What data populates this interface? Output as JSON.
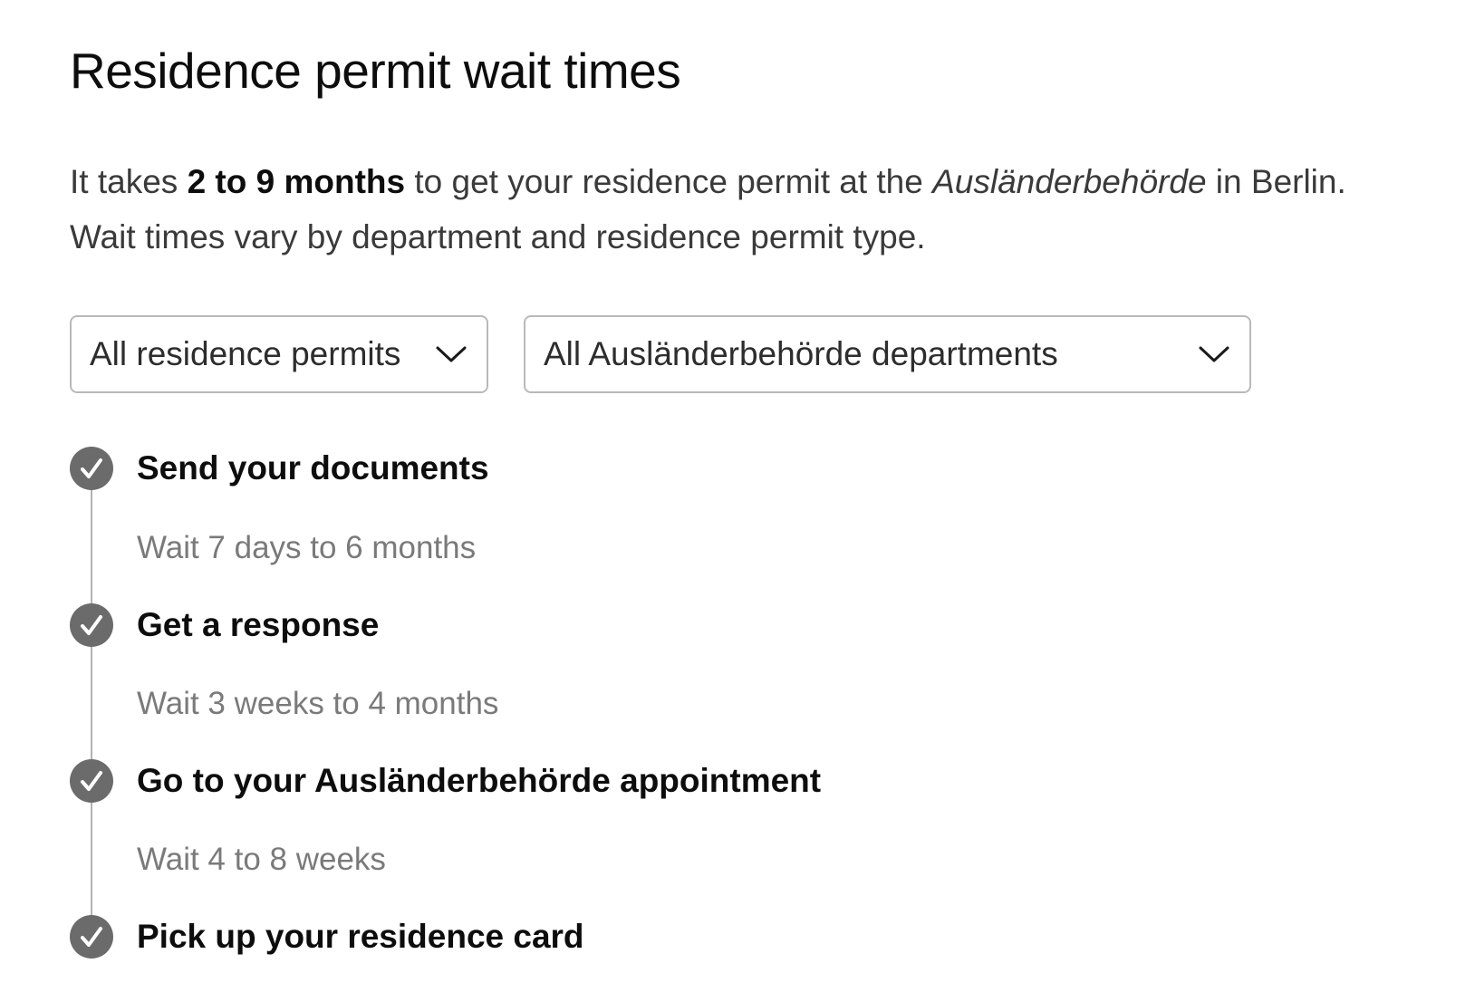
{
  "title": "Residence permit wait times",
  "intro": {
    "prefix": "It takes ",
    "highlight": "2 to 9 months",
    "middle": " to get your residence permit at the ",
    "office": "Ausländerbehörde",
    "suffix": " in Berlin.",
    "line2": "Wait times vary by department and residence permit type."
  },
  "filters": {
    "permit_type": {
      "selected": "All residence permits",
      "icon": "chevron-down-icon"
    },
    "department": {
      "selected": "All Ausländerbehörde departments",
      "icon": "chevron-down-icon"
    }
  },
  "steps": [
    {
      "title": "Send your documents",
      "wait": "Wait 7 days to 6 months",
      "icon": "check-circle-icon"
    },
    {
      "title": "Get a response",
      "wait": "Wait 3 weeks to 4 months",
      "icon": "check-circle-icon"
    },
    {
      "title": "Go to your Ausländerbehörde appointment",
      "wait": "Wait 4 to 8 weeks",
      "icon": "check-circle-icon"
    },
    {
      "title": "Pick up your residence card",
      "icon": "check-circle-icon"
    }
  ],
  "colors": {
    "step_icon": "#6b6b6b",
    "rail": "#b3b3b3",
    "wait_text": "#7a7a7a",
    "border": "#b9b9b9"
  }
}
